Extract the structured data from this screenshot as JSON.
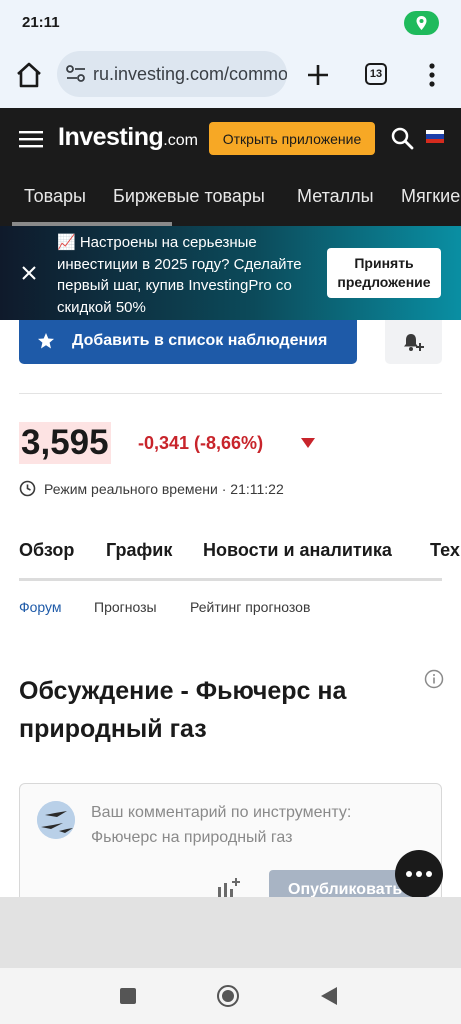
{
  "status_bar": {
    "time": "21:11",
    "location_icon": "location-pin-icon"
  },
  "browser": {
    "url": "ru.investing.com/commodities/natural-gas-commentary",
    "tab_count": "13"
  },
  "header": {
    "logo_main": "Investing",
    "logo_suffix": ".com",
    "open_app_label": "Открыть приложение",
    "flag_colors": [
      "#ffffff",
      "#1c3faa",
      "#d52b1e"
    ]
  },
  "category_nav": {
    "items": [
      "Товары",
      "Биржевые товары",
      "Металлы",
      "Мягкие"
    ]
  },
  "promo": {
    "text": "📈 Настроены на серьезные инвестиции в 2025 году? Сделайте первый шаг, купив InvestingPro со скидкой 50%",
    "accept_label": "Принять предложение"
  },
  "watchlist": {
    "label": "Добавить в список наблюдения"
  },
  "quote": {
    "price": "3,595",
    "change": "-0,341 (-8,66%)",
    "realtime": "Режим реального времени · 21:11:22",
    "negative_color": "#c8242b"
  },
  "tabs": {
    "items": [
      "Обзор",
      "График",
      "Новости и аналитика",
      "Техн"
    ]
  },
  "subtabs": {
    "items": [
      "Форум",
      "Прогнозы",
      "Рейтинг прогнозов"
    ],
    "active": "Форум"
  },
  "discussion": {
    "title": "Обсуждение - Фьючерс на природный газ",
    "placeholder": "Ваш комментарий по инструменту: Фьючерс на природный газ",
    "publish_label": "Опубликовать"
  },
  "colors": {
    "accent": "#1e5aa8",
    "brand_orange": "#f7a825",
    "header_bg": "#1b1b1b"
  }
}
